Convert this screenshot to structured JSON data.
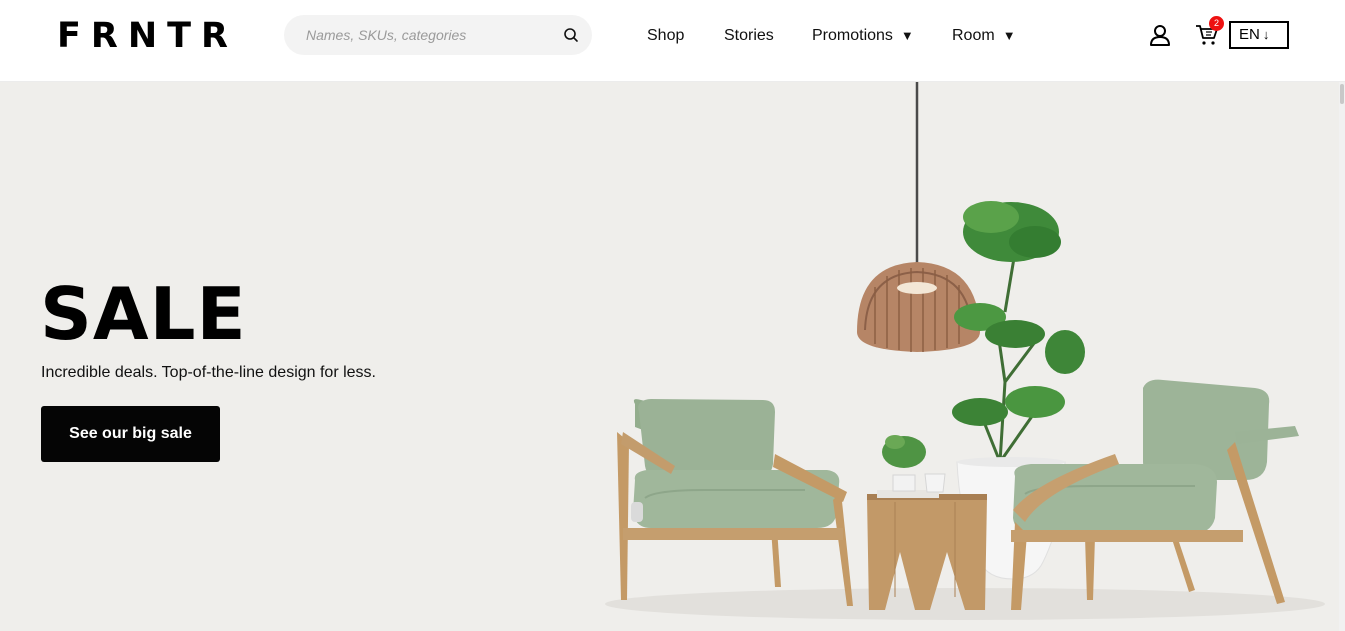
{
  "header": {
    "logo": "FRNTR",
    "search": {
      "placeholder": "Names, SKUs, categories",
      "icon": "search-icon"
    },
    "nav": {
      "shop": "Shop",
      "stories": "Stories",
      "promotions": "Promotions",
      "room": "Room"
    },
    "cart_count": "2",
    "language": "EN",
    "colors": {
      "badge": "#ee1111"
    }
  },
  "hero": {
    "title": "SALE",
    "subtitle": "Incredible deals. Top-of-the-line design for less.",
    "cta": "See our big sale",
    "colors": {
      "background": "#efeeeb",
      "button": "#050505",
      "chair": "#9bb296"
    }
  }
}
